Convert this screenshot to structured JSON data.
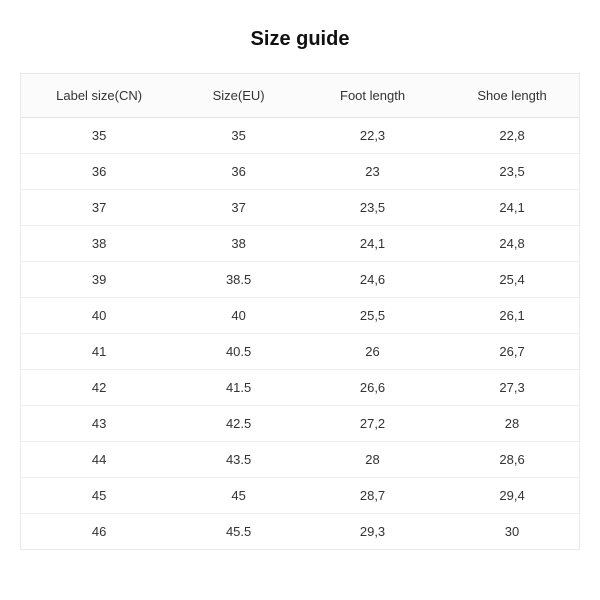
{
  "title": "Size guide",
  "chart_data": {
    "type": "table",
    "columns": [
      "Label size(CN)",
      "Size(EU)",
      "Foot length",
      "Shoe length"
    ],
    "rows": [
      [
        "35",
        "35",
        "22,3",
        "22,8"
      ],
      [
        "36",
        "36",
        "23",
        "23,5"
      ],
      [
        "37",
        "37",
        "23,5",
        "24,1"
      ],
      [
        "38",
        "38",
        "24,1",
        "24,8"
      ],
      [
        "39",
        "38.5",
        "24,6",
        "25,4"
      ],
      [
        "40",
        "40",
        "25,5",
        "26,1"
      ],
      [
        "41",
        "40.5",
        "26",
        "26,7"
      ],
      [
        "42",
        "41.5",
        "26,6",
        "27,3"
      ],
      [
        "43",
        "42.5",
        "27,2",
        "28"
      ],
      [
        "44",
        "43.5",
        "28",
        "28,6"
      ],
      [
        "45",
        "45",
        "28,7",
        "29,4"
      ],
      [
        "46",
        "45.5",
        "29,3",
        "30"
      ]
    ]
  }
}
